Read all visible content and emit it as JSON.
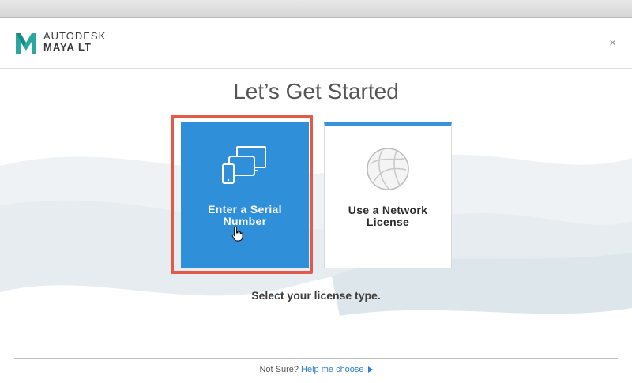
{
  "header": {
    "brand_line1": "AUTODESK",
    "brand_line2": "MAYA LT",
    "logo_icon": "maya-m-logo",
    "close_icon": "close-icon",
    "close_glyph": "×"
  },
  "main": {
    "title": "Let’s Get Started",
    "cards": [
      {
        "label_line1": "Enter a Serial",
        "label_line2": "Number",
        "icon": "devices-icon",
        "selected": true
      },
      {
        "label_line1": "Use a Network",
        "label_line2": "License",
        "icon": "globe-icon",
        "selected": false
      }
    ],
    "subtitle": "Select your license type."
  },
  "footer": {
    "prefix": "Not Sure?",
    "link": "Help me choose",
    "link_icon": "play-arrow-icon"
  },
  "colors": {
    "card_selected": "#2f8fd8",
    "highlight": "#e25b4a",
    "link": "#2f7fcf"
  }
}
